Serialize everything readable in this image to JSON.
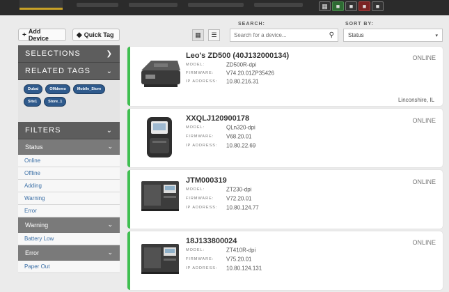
{
  "toolbar": {
    "add_device": "Add Device",
    "quick_tag": "Quick Tag",
    "search_label": "SEARCH:",
    "search_placeholder": "Search for a device...",
    "sort_label": "SORT BY:",
    "sort_value": "Status"
  },
  "sidebar": {
    "selections": "SELECTIONS",
    "related_tags": "RELATED TAGS",
    "tags": [
      "Dubai",
      "OMdemo",
      "Mobile_Store",
      "Site1",
      "Store_1"
    ],
    "filters": "FILTERS",
    "status_group": "Status",
    "status_items": [
      "Online",
      "Offline",
      "Adding",
      "Warning",
      "Error"
    ],
    "warning_group": "Warning",
    "warning_items": [
      "Battery Low"
    ],
    "error_group": "Error",
    "error_items": [
      "Paper Out"
    ]
  },
  "field_labels": {
    "model": "MODEL:",
    "firmware": "FIRMWARE:",
    "ip": "IP ADDRESS:"
  },
  "devices": [
    {
      "name": "Leo's ZD500 (40J132000134)",
      "model": "ZD500R-dpi",
      "firmware": "V74.20.01ZP35426",
      "ip": "10.80.216.31",
      "status": "ONLINE",
      "location": "Linconshire, IL"
    },
    {
      "name": "XXQLJ120900178",
      "model": "QLn320-dpi",
      "firmware": "V68.20.01",
      "ip": "10.80.22.69",
      "status": "ONLINE",
      "location": ""
    },
    {
      "name": "JTM000319",
      "model": "ZT230-dpi",
      "firmware": "V72.20.01",
      "ip": "10.80.124.77",
      "status": "ONLINE",
      "location": ""
    },
    {
      "name": "18J133800024",
      "model": "ZT410R-dpi",
      "firmware": "V75.20.01",
      "ip": "10.80.124.131",
      "status": "ONLINE",
      "location": ""
    }
  ],
  "colors": {
    "online_accent": "#3fbf50",
    "tag_bg": "#2f5a8c",
    "link": "#3b6fa6"
  }
}
